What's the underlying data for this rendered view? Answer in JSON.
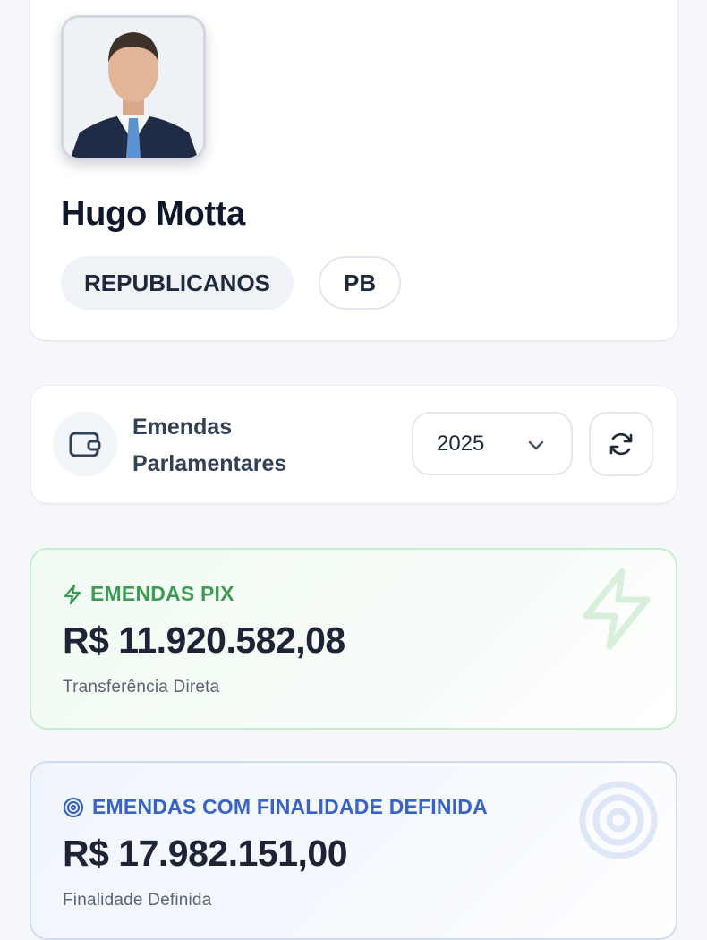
{
  "profile": {
    "name": "Hugo Motta",
    "party": "REPUBLICANOS",
    "state": "PB",
    "photo_icon": "person-photo"
  },
  "emendas": {
    "title": "Emendas Parlamentares",
    "icon": "wallet-icon",
    "year": "2025",
    "refresh_icon": "refresh-icon"
  },
  "cards": {
    "pix": {
      "label": "EMENDAS PIX",
      "value": "R$ 11.920.582,08",
      "subtitle": "Transferência Direta",
      "icon": "lightning-icon",
      "accent": "#3f9a53"
    },
    "finalidade": {
      "label": "EMENDAS COM FINALIDADE DEFINIDA",
      "value": "R$ 17.982.151,00",
      "subtitle": "Finalidade Definida",
      "icon": "target-icon",
      "accent": "#3a63c8"
    }
  }
}
